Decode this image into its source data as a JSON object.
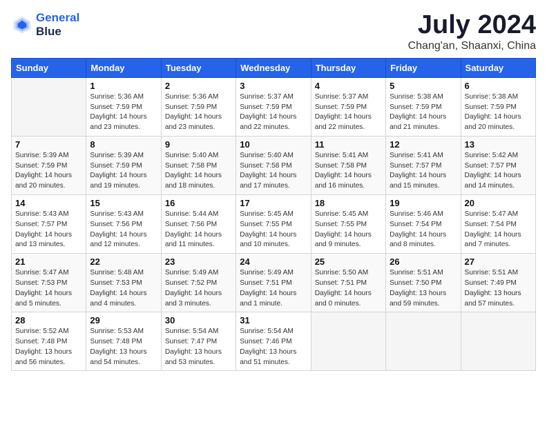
{
  "header": {
    "logo_line1": "General",
    "logo_line2": "Blue",
    "month_year": "July 2024",
    "location": "Chang'an, Shaanxi, China"
  },
  "days_of_week": [
    "Sunday",
    "Monday",
    "Tuesday",
    "Wednesday",
    "Thursday",
    "Friday",
    "Saturday"
  ],
  "weeks": [
    [
      {
        "day": "",
        "empty": true
      },
      {
        "day": "1",
        "sunrise": "5:36 AM",
        "sunset": "7:59 PM",
        "daylight": "14 hours and 23 minutes."
      },
      {
        "day": "2",
        "sunrise": "5:36 AM",
        "sunset": "7:59 PM",
        "daylight": "14 hours and 23 minutes."
      },
      {
        "day": "3",
        "sunrise": "5:37 AM",
        "sunset": "7:59 PM",
        "daylight": "14 hours and 22 minutes."
      },
      {
        "day": "4",
        "sunrise": "5:37 AM",
        "sunset": "7:59 PM",
        "daylight": "14 hours and 22 minutes."
      },
      {
        "day": "5",
        "sunrise": "5:38 AM",
        "sunset": "7:59 PM",
        "daylight": "14 hours and 21 minutes."
      },
      {
        "day": "6",
        "sunrise": "5:38 AM",
        "sunset": "7:59 PM",
        "daylight": "14 hours and 20 minutes."
      }
    ],
    [
      {
        "day": "7",
        "sunrise": "5:39 AM",
        "sunset": "7:59 PM",
        "daylight": "14 hours and 20 minutes."
      },
      {
        "day": "8",
        "sunrise": "5:39 AM",
        "sunset": "7:59 PM",
        "daylight": "14 hours and 19 minutes."
      },
      {
        "day": "9",
        "sunrise": "5:40 AM",
        "sunset": "7:58 PM",
        "daylight": "14 hours and 18 minutes."
      },
      {
        "day": "10",
        "sunrise": "5:40 AM",
        "sunset": "7:58 PM",
        "daylight": "14 hours and 17 minutes."
      },
      {
        "day": "11",
        "sunrise": "5:41 AM",
        "sunset": "7:58 PM",
        "daylight": "14 hours and 16 minutes."
      },
      {
        "day": "12",
        "sunrise": "5:41 AM",
        "sunset": "7:57 PM",
        "daylight": "14 hours and 15 minutes."
      },
      {
        "day": "13",
        "sunrise": "5:42 AM",
        "sunset": "7:57 PM",
        "daylight": "14 hours and 14 minutes."
      }
    ],
    [
      {
        "day": "14",
        "sunrise": "5:43 AM",
        "sunset": "7:57 PM",
        "daylight": "14 hours and 13 minutes."
      },
      {
        "day": "15",
        "sunrise": "5:43 AM",
        "sunset": "7:56 PM",
        "daylight": "14 hours and 12 minutes."
      },
      {
        "day": "16",
        "sunrise": "5:44 AM",
        "sunset": "7:56 PM",
        "daylight": "14 hours and 11 minutes."
      },
      {
        "day": "17",
        "sunrise": "5:45 AM",
        "sunset": "7:55 PM",
        "daylight": "14 hours and 10 minutes."
      },
      {
        "day": "18",
        "sunrise": "5:45 AM",
        "sunset": "7:55 PM",
        "daylight": "14 hours and 9 minutes."
      },
      {
        "day": "19",
        "sunrise": "5:46 AM",
        "sunset": "7:54 PM",
        "daylight": "14 hours and 8 minutes."
      },
      {
        "day": "20",
        "sunrise": "5:47 AM",
        "sunset": "7:54 PM",
        "daylight": "14 hours and 7 minutes."
      }
    ],
    [
      {
        "day": "21",
        "sunrise": "5:47 AM",
        "sunset": "7:53 PM",
        "daylight": "14 hours and 5 minutes."
      },
      {
        "day": "22",
        "sunrise": "5:48 AM",
        "sunset": "7:53 PM",
        "daylight": "14 hours and 4 minutes."
      },
      {
        "day": "23",
        "sunrise": "5:49 AM",
        "sunset": "7:52 PM",
        "daylight": "14 hours and 3 minutes."
      },
      {
        "day": "24",
        "sunrise": "5:49 AM",
        "sunset": "7:51 PM",
        "daylight": "14 hours and 1 minute."
      },
      {
        "day": "25",
        "sunrise": "5:50 AM",
        "sunset": "7:51 PM",
        "daylight": "14 hours and 0 minutes."
      },
      {
        "day": "26",
        "sunrise": "5:51 AM",
        "sunset": "7:50 PM",
        "daylight": "13 hours and 59 minutes."
      },
      {
        "day": "27",
        "sunrise": "5:51 AM",
        "sunset": "7:49 PM",
        "daylight": "13 hours and 57 minutes."
      }
    ],
    [
      {
        "day": "28",
        "sunrise": "5:52 AM",
        "sunset": "7:48 PM",
        "daylight": "13 hours and 56 minutes."
      },
      {
        "day": "29",
        "sunrise": "5:53 AM",
        "sunset": "7:48 PM",
        "daylight": "13 hours and 54 minutes."
      },
      {
        "day": "30",
        "sunrise": "5:54 AM",
        "sunset": "7:47 PM",
        "daylight": "13 hours and 53 minutes."
      },
      {
        "day": "31",
        "sunrise": "5:54 AM",
        "sunset": "7:46 PM",
        "daylight": "13 hours and 51 minutes."
      },
      {
        "day": "",
        "empty": true
      },
      {
        "day": "",
        "empty": true
      },
      {
        "day": "",
        "empty": true
      }
    ]
  ]
}
